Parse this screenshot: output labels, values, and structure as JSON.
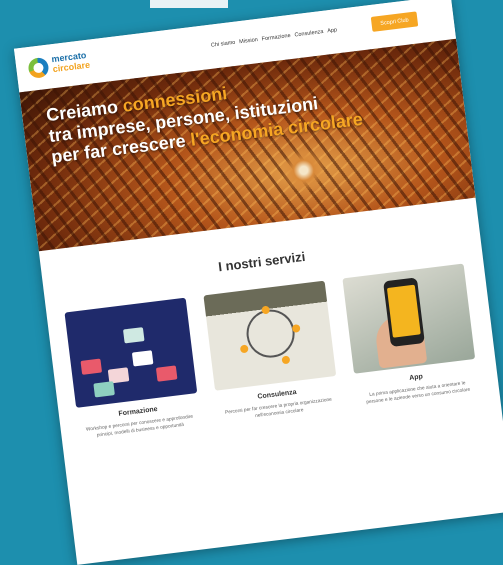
{
  "header": {
    "logo_line1": "mercato",
    "logo_line2": "circolare",
    "nav": [
      "Chi siamo",
      "Mission",
      "Formazione",
      "Consulenza",
      "App"
    ],
    "cta": "Scopri Club"
  },
  "hero": {
    "line1_pre": "Creiamo ",
    "line1_accent": "connessioni",
    "line2": "tra imprese, persone, istituzioni",
    "line3_pre": "per far crescere ",
    "line3_accent": "l'economia circolare"
  },
  "services": {
    "title": "I nostri servizi",
    "cards": [
      {
        "title": "Formazione",
        "desc": "Workshop e percorsi per conoscere e approfondire principi, modelli di business e opportunità"
      },
      {
        "title": "Consulenza",
        "desc": "Percorsi per far crescere la propria organizzazione nell'economia circolare"
      },
      {
        "title": "App",
        "desc": "La prima applicazione che aiuta a orientare le persone e le aziende verso un consumo circolare"
      }
    ]
  },
  "colors": {
    "background": "#1d8fae",
    "accent": "#f6a623",
    "text": "#333333"
  }
}
